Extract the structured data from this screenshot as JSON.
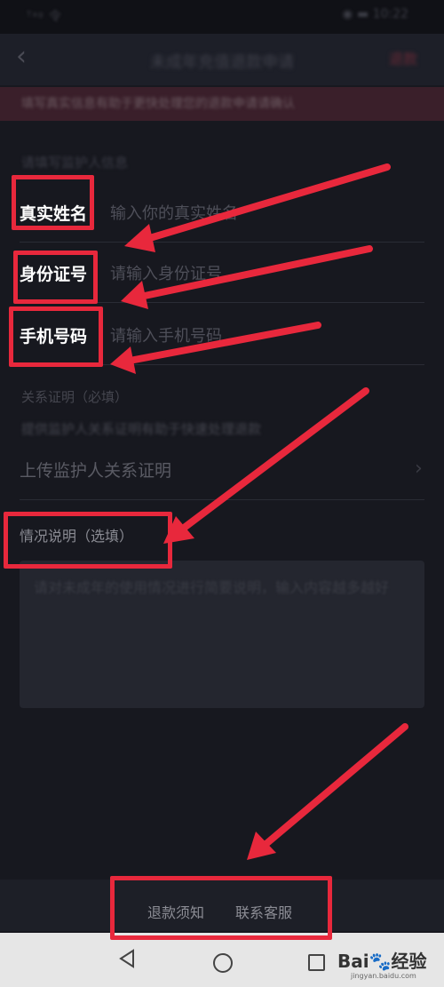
{
  "status_bar": {
    "left": "ᵀᵃᵍ 令",
    "right": "◉ ▬ 10:22"
  },
  "header": {
    "title": "未成年充值退款申请",
    "right": "退款"
  },
  "notice": {
    "text": "填写真实信息有助于更快处理您的退款申请请确认"
  },
  "form": {
    "guardian_section_label": "请填写监护人信息",
    "fields": [
      {
        "label": "真实姓名",
        "placeholder": "输入你的真实姓名"
      },
      {
        "label": "身份证号",
        "placeholder": "请输入身份证号"
      },
      {
        "label": "手机号码",
        "placeholder": "请输入手机号码"
      }
    ],
    "relation_label": "关系证明（必填）",
    "relation_hint": "提供监护人关系证明有助于快速处理退款",
    "upload_label": "上传监护人关系证明",
    "upload_chevron": "›",
    "situation_label": "情况说明（选填）",
    "situation_placeholder": "请对未成年的使用情况进行简要说明，输入内容越多越好"
  },
  "footer": {
    "refund_notice": "退款须知",
    "contact_service": "联系客服"
  },
  "nav": {
    "back": "back",
    "home": "home",
    "recent": "recent"
  },
  "watermark": {
    "brand": "Bai🐾经验",
    "site": "jingyan.baidu.com"
  }
}
